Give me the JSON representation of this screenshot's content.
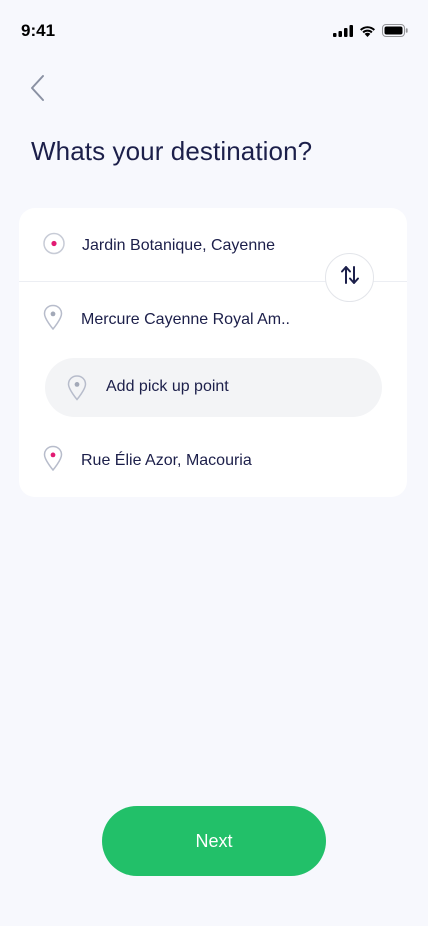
{
  "status_bar": {
    "time": "9:41"
  },
  "header": {
    "title": "Whats your destination?"
  },
  "route": {
    "origin": "Jardin Botanique, Cayenne",
    "stop": "Mercure Cayenne Royal Am..",
    "add_stop_label": "Add pick up point",
    "destination": "Rue Élie Azor, Macouria"
  },
  "actions": {
    "next_label": "Next"
  },
  "colors": {
    "background": "#f7f8fd",
    "title": "#1c1f4a",
    "accent_pink": "#e21b73",
    "primary_green": "#22c069",
    "muted_icon": "#a3a9b8"
  },
  "icons": {
    "back": "chevron-left-icon",
    "origin": "origin-dot-icon",
    "stop": "location-pin-icon",
    "add_stop": "location-pin-icon",
    "destination": "destination-pin-icon",
    "swap": "swap-vertical-icon",
    "signal": "cellular-signal-icon",
    "wifi": "wifi-icon",
    "battery": "battery-icon"
  }
}
